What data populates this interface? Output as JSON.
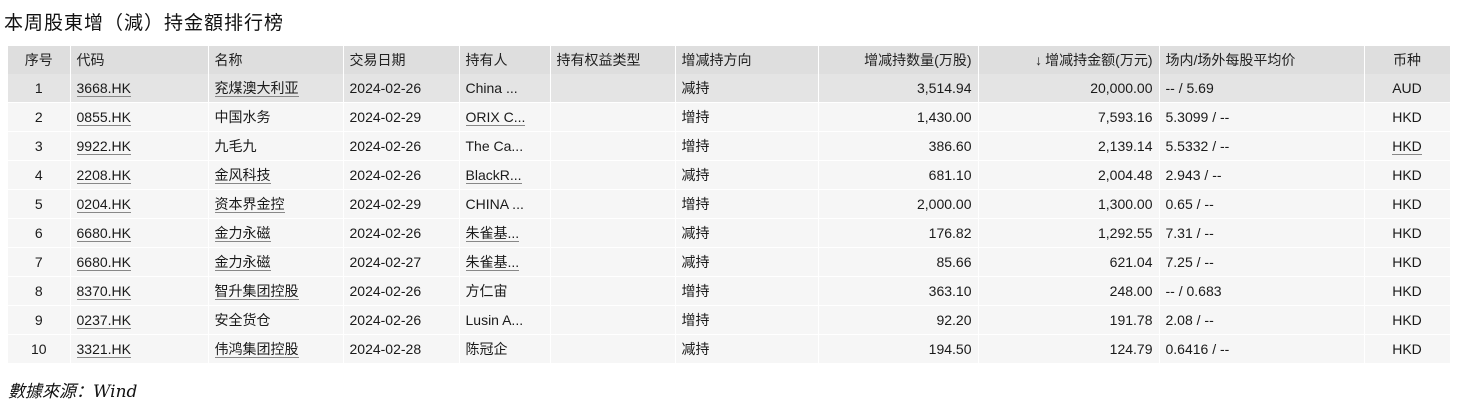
{
  "title": "本周股東增（減）持金額排行榜",
  "columns": {
    "seq": "序号",
    "code": "代码",
    "name": "名称",
    "date": "交易日期",
    "holder": "持有人",
    "equity_type": "持有权益类型",
    "direction": "增减持方向",
    "quantity": "增减持数量(万股)",
    "amount_arrow": "↓",
    "amount": "增减持金额(万元)",
    "avg_price": "场内/场外每股平均价",
    "currency": "币种"
  },
  "rows": [
    {
      "seq": "1",
      "code": "3668.HK",
      "name": "兖煤澳大利亚",
      "date": "2024-02-26",
      "holder": "China ...",
      "equity_type": "",
      "direction": "减持",
      "quantity": "3,514.94",
      "amount": "20,000.00",
      "avg_price": "-- / 5.69",
      "currency": "AUD"
    },
    {
      "seq": "2",
      "code": "0855.HK",
      "name": "中国水务",
      "date": "2024-02-29",
      "holder": "ORIX C...",
      "equity_type": "",
      "direction": "增持",
      "quantity": "1,430.00",
      "amount": "7,593.16",
      "avg_price": "5.3099 / --",
      "currency": "HKD"
    },
    {
      "seq": "3",
      "code": "9922.HK",
      "name": "九毛九",
      "date": "2024-02-26",
      "holder": "The Ca...",
      "equity_type": "",
      "direction": "增持",
      "quantity": "386.60",
      "amount": "2,139.14",
      "avg_price": "5.5332 / --",
      "currency": "HKD"
    },
    {
      "seq": "4",
      "code": "2208.HK",
      "name": "金风科技",
      "date": "2024-02-26",
      "holder": "BlackR...",
      "equity_type": "",
      "direction": "减持",
      "quantity": "681.10",
      "amount": "2,004.48",
      "avg_price": "2.943 / --",
      "currency": "HKD"
    },
    {
      "seq": "5",
      "code": "0204.HK",
      "name": "资本界金控",
      "date": "2024-02-29",
      "holder": "CHINA ...",
      "equity_type": "",
      "direction": "增持",
      "quantity": "2,000.00",
      "amount": "1,300.00",
      "avg_price": "0.65 / --",
      "currency": "HKD"
    },
    {
      "seq": "6",
      "code": "6680.HK",
      "name": "金力永磁",
      "date": "2024-02-26",
      "holder": "朱雀基...",
      "equity_type": "",
      "direction": "减持",
      "quantity": "176.82",
      "amount": "1,292.55",
      "avg_price": "7.31 / --",
      "currency": "HKD"
    },
    {
      "seq": "7",
      "code": "6680.HK",
      "name": "金力永磁",
      "date": "2024-02-27",
      "holder": "朱雀基...",
      "equity_type": "",
      "direction": "减持",
      "quantity": "85.66",
      "amount": "621.04",
      "avg_price": "7.25 / --",
      "currency": "HKD"
    },
    {
      "seq": "8",
      "code": "8370.HK",
      "name": "智升集团控股",
      "date": "2024-02-26",
      "holder": "方仁宙",
      "equity_type": "",
      "direction": "增持",
      "quantity": "363.10",
      "amount": "248.00",
      "avg_price": "-- / 0.683",
      "currency": "HKD"
    },
    {
      "seq": "9",
      "code": "0237.HK",
      "name": "安全货仓",
      "date": "2024-02-26",
      "holder": "Lusin A...",
      "equity_type": "",
      "direction": "增持",
      "quantity": "92.20",
      "amount": "191.78",
      "avg_price": "2.08 / --",
      "currency": "HKD"
    },
    {
      "seq": "10",
      "code": "3321.HK",
      "name": "伟鸿集团控股",
      "date": "2024-02-28",
      "holder": "陈冠企",
      "equity_type": "",
      "direction": "减持",
      "quantity": "194.50",
      "amount": "124.79",
      "avg_price": "0.6416 / --",
      "currency": "HKD"
    }
  ],
  "linked_holders": [
    2,
    4,
    6,
    7
  ],
  "linked_names": [
    1,
    4,
    5,
    6,
    7,
    8,
    10
  ],
  "linked_currency": [
    3
  ],
  "source": "數據來源：Wind"
}
